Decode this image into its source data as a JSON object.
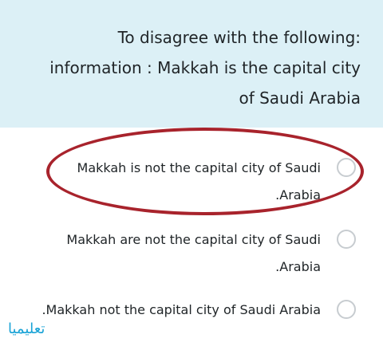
{
  "question": {
    "lines": [
      "To disagree with the following:",
      "information : Makkah is the capital city",
      "of Saudi Arabia"
    ]
  },
  "options": [
    {
      "lines": [
        "Makkah is not the capital city of Saudi",
        ".Arabia"
      ],
      "selected": false,
      "highlighted": true
    },
    {
      "lines": [
        "Makkah are not the capital city of Saudi",
        ".Arabia"
      ],
      "selected": false,
      "highlighted": false
    },
    {
      "lines": [
        ".Makkah not the capital city of Saudi Arabia"
      ],
      "selected": false,
      "highlighted": false
    }
  ],
  "watermark": "تعليميا",
  "colors": {
    "header_bg": "#dcf0f6",
    "highlight_ring": "#a8232c",
    "radio_border": "#c7ccd0",
    "watermark": "#1aa3d6"
  }
}
